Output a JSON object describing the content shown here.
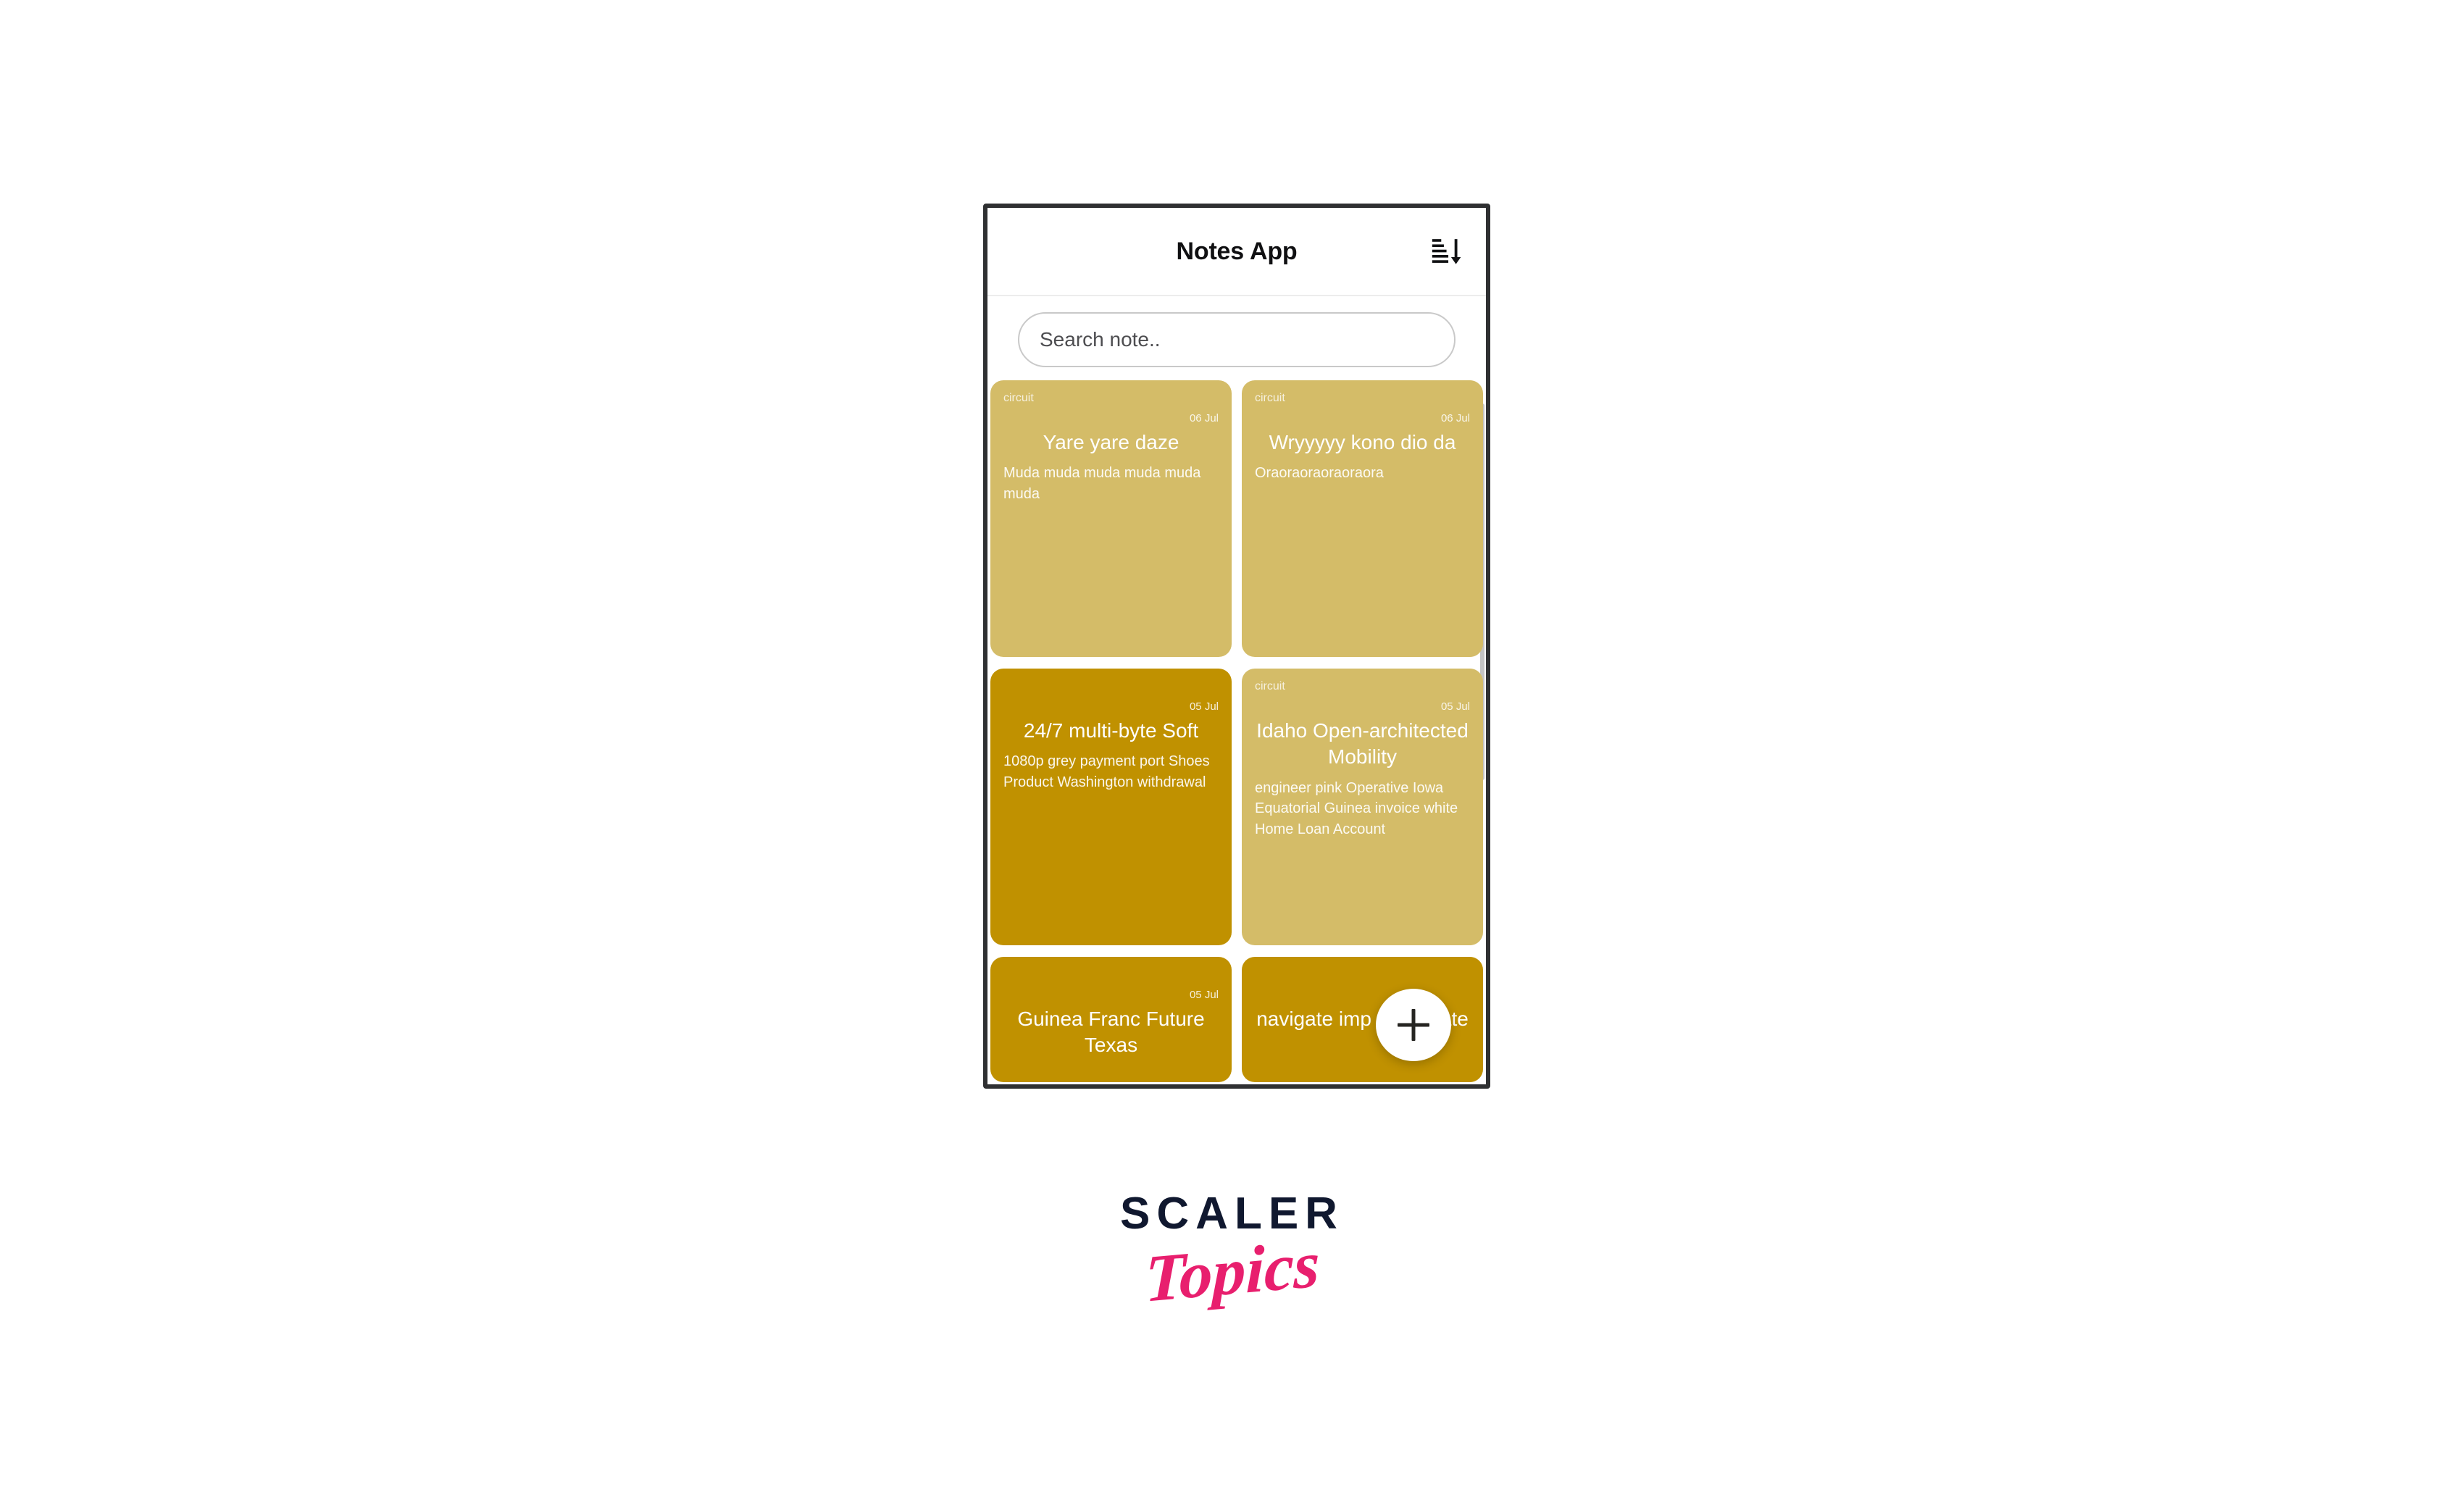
{
  "app": {
    "title": "Notes App",
    "sort_icon": "sort-descending-icon"
  },
  "search": {
    "placeholder": "Search note..",
    "value": ""
  },
  "fab": {
    "icon": "plus-icon",
    "label": "+"
  },
  "colors": {
    "card_light": "#D4BC68",
    "card_dark": "#C09100",
    "frame": "#2f3032",
    "title_text": "#101012",
    "logo_dark": "#10182f",
    "logo_pink": "#e81f6e"
  },
  "notes": [
    {
      "label": "circuit",
      "date": "06 Jul",
      "title": "Yare yare daze",
      "body": "Muda muda muda muda muda muda",
      "color": "#D4BC68"
    },
    {
      "label": "circuit",
      "date": "06 Jul",
      "title": "Wryyyyy kono dio da",
      "body": "Oraoraoraoraoraora",
      "color": "#D4BC68"
    },
    {
      "label": "",
      "date": "05 Jul",
      "title": "24/7 multi-byte Soft",
      "body": "1080p grey payment port Shoes Product Washington withdrawal",
      "color": "#C09100"
    },
    {
      "label": "circuit",
      "date": "05 Jul",
      "title": "Idaho Open-architected Mobility",
      "body": "engineer pink Operative Iowa Equatorial Guinea invoice white Home Loan Account",
      "color": "#D4BC68"
    },
    {
      "label": "",
      "date": "05 Jul",
      "title": "Guinea Franc Future Texas",
      "body": "",
      "color": "#C09100"
    },
    {
      "label": "",
      "date": "",
      "title": "navigate imp solid state",
      "body": "",
      "color": "#C09100"
    }
  ],
  "branding": {
    "scaler": "SCALER",
    "topics": "Topics"
  }
}
